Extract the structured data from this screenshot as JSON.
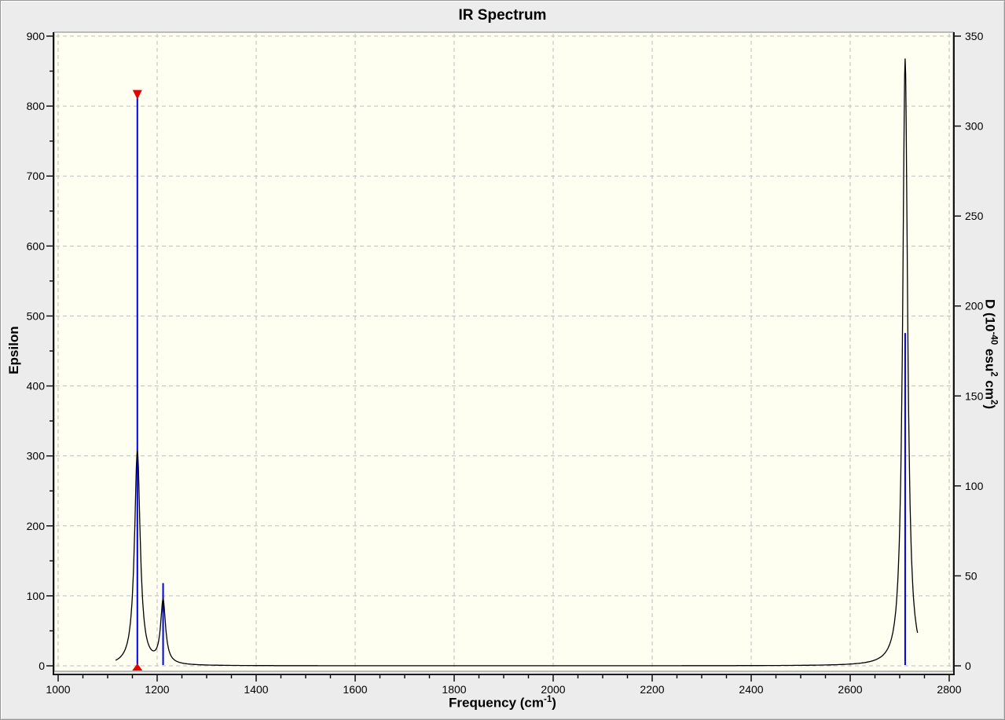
{
  "chart_data": {
    "type": "line",
    "title": "IR Spectrum",
    "x_axis": {
      "label_plain": "Frequency (cm-1)",
      "label_segments": [
        {
          "t": "Frequency (cm"
        },
        {
          "t": "-1",
          "sup": true
        },
        {
          "t": ")"
        }
      ],
      "min": 1000,
      "max": 2800,
      "major_step": 200,
      "minor_step": 50,
      "tick_labels": [
        "1000",
        "1200",
        "1400",
        "1600",
        "1800",
        "2000",
        "2200",
        "2400",
        "2600",
        "2800"
      ]
    },
    "left_axis": {
      "label": "Epsilon",
      "min": 0,
      "max": 900,
      "major_step": 100,
      "minor_step": 50,
      "tick_labels": [
        "0",
        "100",
        "200",
        "300",
        "400",
        "500",
        "600",
        "700",
        "800",
        "900"
      ]
    },
    "right_axis": {
      "label_plain": "D (10-40 esu2 cm2)",
      "label_segments": [
        {
          "t": "D (10"
        },
        {
          "t": "-40",
          "sup": true
        },
        {
          "t": " esu"
        },
        {
          "t": "2",
          "sup": true
        },
        {
          "t": " cm"
        },
        {
          "t": "2",
          "sup": true
        },
        {
          "t": ")"
        }
      ],
      "min": 0,
      "max": 350,
      "major_step": 50,
      "tick_labels": [
        "0",
        "50",
        "100",
        "150",
        "200",
        "250",
        "300",
        "350"
      ]
    },
    "grid": {
      "style": "dashed",
      "on": true
    },
    "series": [
      {
        "name": "epsilon-curve",
        "type": "line",
        "axis": "left",
        "domain": [
          1116,
          2736
        ],
        "peaks": [
          {
            "freq": 1160,
            "epsilon_max": 306,
            "fwhm": 14
          },
          {
            "freq": 1212,
            "epsilon_max": 90,
            "fwhm": 12
          },
          {
            "freq": 2711,
            "epsilon_max": 868,
            "fwhm": 12
          }
        ]
      },
      {
        "name": "dipole-strength-sticks",
        "type": "stem",
        "axis": "right",
        "points": [
          {
            "freq": 1160,
            "d": 317
          },
          {
            "freq": 1212,
            "d": 46
          },
          {
            "freq": 2711,
            "d": 185
          }
        ]
      }
    ],
    "selected_mode": {
      "freq": 1160
    }
  },
  "colors": {
    "window_bg": "#ececec",
    "plot_bg": "#fefef1",
    "plot_border": "#a6a6a6",
    "grid": "#bfbfbf",
    "axis": "#000000",
    "curve": "#000000",
    "stick_blue": "#0000e8",
    "marker_red": "#e60000",
    "text": "#000000"
  }
}
